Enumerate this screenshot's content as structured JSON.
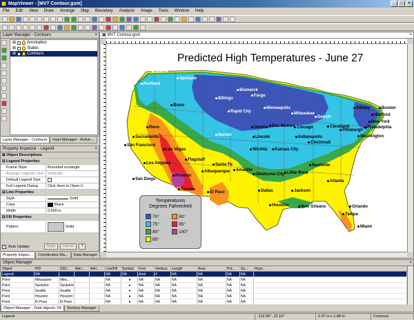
{
  "window": {
    "title": "MapViewer - [MV7 Contour.gsm]"
  },
  "menu": [
    "File",
    "Edit",
    "View",
    "Draw",
    "Arrange",
    "Map",
    "Boundary",
    "Analysis",
    "Image",
    "Tools",
    "Window",
    "Help"
  ],
  "layer_manager": {
    "title": "Layer Manager - Contours",
    "layers": [
      "Annotation",
      "States",
      "Contours"
    ],
    "tabs": [
      "Layer Manager - Contours",
      "Inset Manager - Active:..."
    ]
  },
  "property_inspector": {
    "title": "Property Inspector - Legend",
    "sections": {
      "desc": "Object Descriptions",
      "legend": "Legend Properties",
      "line": "Line Properties",
      "fill": "Fill Properties"
    },
    "rows": {
      "frame_style": {
        "k": "Frame Style",
        "v": "Rounded rectangle"
      },
      "arrange": {
        "k": "Arrange Legends One...",
        "v": "Vertically"
      },
      "default_size": {
        "k": "Default Legend Size",
        "v": ""
      },
      "full_dialog": {
        "k": "Full Legend Dialog",
        "v": "Click Here to Open It"
      },
      "style": {
        "k": "Style",
        "v": "Solid"
      },
      "color": {
        "k": "Color",
        "v": "Black"
      },
      "width": {
        "k": "Width",
        "v": "0.000 in"
      },
      "pattern": {
        "k": "Pattern",
        "v": "Solid"
      }
    },
    "auto_update": "Auto Update",
    "apply": "Apply",
    "cancel": "Cancel",
    "help": "?",
    "tabs": [
      "Property Inspec...",
      "Coordinates Ma...",
      "Data Manager"
    ]
  },
  "map_window": {
    "tab": "MV7 Contour.gsm"
  },
  "map": {
    "title": "Predicted High Temperatures - June 27",
    "legend_title": "Temperatures",
    "legend_subtitle": "Degrees Fahrenheit",
    "legend_items": [
      {
        "label": "70°",
        "color": "#3b55b8"
      },
      {
        "label": "75°",
        "color": "#33c4e6"
      },
      {
        "label": "80°",
        "color": "#38a84a"
      },
      {
        "label": "85°",
        "color": "#fff200"
      },
      {
        "label": "90°",
        "color": "#f7941d"
      },
      {
        "label": "95°",
        "color": "#e8202a"
      },
      {
        "label": "100°",
        "color": "#b83fa0"
      }
    ],
    "cities": [
      {
        "name": "Seattle",
        "w": true
      },
      {
        "name": "Spokane",
        "w": true
      },
      {
        "name": "Portland",
        "w": true
      },
      {
        "name": "Boise",
        "w": false
      },
      {
        "name": "Billings",
        "w": true
      },
      {
        "name": "Bismarck",
        "w": true
      },
      {
        "name": "Fargo",
        "w": true
      },
      {
        "name": "Rapid City",
        "w": true
      },
      {
        "name": "Minneapolis",
        "w": true
      },
      {
        "name": "Milwaukee",
        "w": true
      },
      {
        "name": "Detroit",
        "w": true
      },
      {
        "name": "Albany",
        "w": false
      },
      {
        "name": "Boston",
        "w": false
      },
      {
        "name": "Hartford",
        "w": false
      },
      {
        "name": "New York",
        "w": false
      },
      {
        "name": "Philadelphia",
        "w": false
      },
      {
        "name": "Washington",
        "w": false
      },
      {
        "name": "Pittsburgh",
        "w": false
      },
      {
        "name": "Cleveland",
        "w": false
      },
      {
        "name": "Chicago",
        "w": false
      },
      {
        "name": "Des Moines",
        "w": false
      },
      {
        "name": "Omaha",
        "w": false
      },
      {
        "name": "Indianapolis",
        "w": false
      },
      {
        "name": "Cincinnati",
        "w": false
      },
      {
        "name": "Lincoln",
        "w": false
      },
      {
        "name": "Denver",
        "w": true
      },
      {
        "name": "Reno",
        "w": false
      },
      {
        "name": "Sacramento",
        "w": false
      },
      {
        "name": "San Francisco",
        "w": false
      },
      {
        "name": "Las Vegas",
        "w": false
      },
      {
        "name": "Los Angeles",
        "w": false
      },
      {
        "name": "San Diego",
        "w": false
      },
      {
        "name": "Phoenix",
        "w": false
      },
      {
        "name": "Tucson",
        "w": false
      },
      {
        "name": "Flagstaff",
        "w": false
      },
      {
        "name": "Santa Fe",
        "w": false
      },
      {
        "name": "Albuquerque",
        "w": false
      },
      {
        "name": "Amarillo",
        "w": false
      },
      {
        "name": "El Paso",
        "w": false
      },
      {
        "name": "Wichita",
        "w": false
      },
      {
        "name": "Kansas City",
        "w": false
      },
      {
        "name": "Oklahoma City",
        "w": false
      },
      {
        "name": "Little Rock",
        "w": false
      },
      {
        "name": "Nashville",
        "w": false
      },
      {
        "name": "Atlanta",
        "w": false
      },
      {
        "name": "Dallas",
        "w": false
      },
      {
        "name": "Jackson",
        "w": false
      },
      {
        "name": "Houston",
        "w": false
      },
      {
        "name": "New Orleans",
        "w": false
      },
      {
        "name": "Orlando",
        "w": false
      },
      {
        "name": "Tampa",
        "w": false
      },
      {
        "name": "Miami",
        "w": false
      }
    ]
  },
  "object_manager": {
    "title": "Object Manager",
    "columns": [
      "Object",
      "PID",
      "SID/...",
      "Attri...",
      "Attri...",
      "Line/Fill",
      "Symbol",
      "Font",
      "Vertices",
      "Length",
      "Area",
      "Pol...",
      "Su...",
      "Hype..."
    ],
    "rows": [
      [
        "Legend",
        "NA",
        "",
        "",
        "",
        "NA",
        "NA",
        "Arial",
        "4",
        "NA",
        "NA",
        "NA",
        "NA",
        ""
      ],
      [
        "Point",
        "Milwaukee",
        "Milw...",
        "",
        "",
        "NA",
        "",
        "NA",
        "NA",
        "NA",
        "NA",
        "NA",
        "NA",
        ""
      ],
      [
        "Point",
        "Spokane",
        "Spokane",
        "",
        "",
        "NA",
        "",
        "NA",
        "NA",
        "NA",
        "NA",
        "NA",
        "NA",
        ""
      ],
      [
        "Point",
        "Seattle",
        "Seattle",
        "",
        "",
        "NA",
        "",
        "NA",
        "NA",
        "NA",
        "NA",
        "NA",
        "NA",
        ""
      ],
      [
        "Point",
        "Houston",
        "Houston",
        "",
        "",
        "NA",
        "",
        "NA",
        "NA",
        "NA",
        "NA",
        "NA",
        "NA",
        ""
      ],
      [
        "Point",
        "El Paso",
        "El Paso",
        "",
        "",
        "NA",
        "",
        "NA",
        "NA",
        "NA",
        "NA",
        "NA",
        "NA",
        ""
      ]
    ],
    "tabs": [
      "Object Manager - Total objects: 54",
      "Territory Manager"
    ]
  },
  "status": {
    "left": "Legend",
    "coords": "-112.06°, 22.10°",
    "size": "2.07 in x 1.88 in",
    "layer": "Contours"
  },
  "colors": {
    "70": "#3b55b8",
    "75": "#33c4e6",
    "80": "#38a84a",
    "85": "#fff200",
    "90": "#f7941d",
    "95": "#e8202a",
    "100": "#b83fa0"
  }
}
